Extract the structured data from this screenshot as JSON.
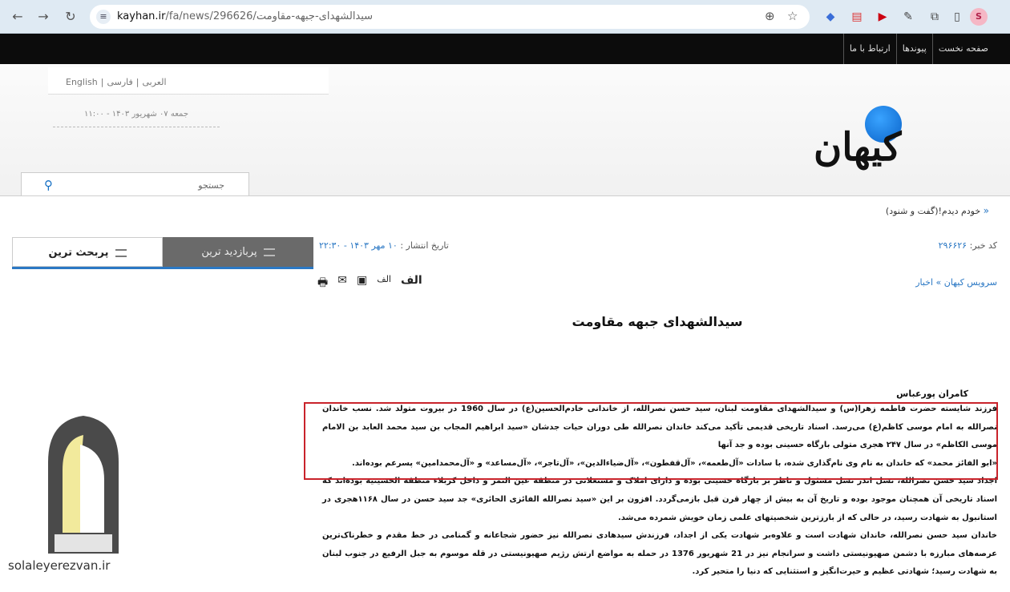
{
  "browser": {
    "domain": "kayhan.ir",
    "path": "/fa/news/296626/سیدالشهدای-جبهه-مقاومت",
    "profile_initial": "S"
  },
  "topnav": [
    "صفحه نخست",
    "پیوندها",
    "ارتباط با ما"
  ],
  "header": {
    "languages": [
      "English",
      "العربی",
      "فارسی"
    ],
    "date": "جمعه ۰۷ شهریور ۱۴۰۳ - ۱۱:۰۰",
    "logo_text": "کیهان",
    "search_label": "جستجو"
  },
  "article": {
    "breadcrumb": "خودم دیدم!(گفت و شنود)",
    "code_label": "کد خبر:",
    "code_value": "۲۹۶۶۲۶",
    "date_label": "تاریخ انتشار :",
    "date_value": "۱۰ مهر ۱۴۰۳ - ۲۲:۳۰",
    "service": "سرویس کیهان » اخبار",
    "title": "سیدالشهدای جبهه مقاومت",
    "author": "کامران پورعباس",
    "paragraphs": [
      "فرزند شایسته حضرت فاطمه زهرا(س) و سیدالشهدای مقاومت لبنان، سید حسن نصرالله، از خاندانی خادم‌الحسین(ع) در سال 1960 در بیروت متولد شد. نسب خاندان نصرالله به امام موسی کاظم(ع) می‌رسد. اسناد تاریخی قدیمی تأکید می‌کند خاندان نصرالله طی دوران حیات جدشان «سید ابراهیم المجاب بن سید محمد العابد بن الامام موسی الکاظم» در سال ۲۴۷ هجری متولی بارگاه حسینی بوده و جد آنها",
      "«ابو الفائز محمد» که خاندان به نام وی نام‌گذاری شده، با سادات «آل‌طعمه»، «آل‌قفطون»، «آل‌ضیاءالدین»، «آل‌تاجر»، «آل‌مساعد» و «آل‌محمدامین» پسرعم بوده‌اند.",
      "اجداد سید حسن نصرالله، نسل اندر نسل مسئول و ناظر بر بارگاه حسینی بوده و دارای املاک و مستغلاتی در منطقه عین التمر و داخل کربلاء منطقه الحسینیه بوده‌اند که اسناد تاریخی آن همچنان موجود بوده و تاریخ آن به بیش از چهار قرن قبل بازمی‌گردد. افزون بر این «سید نصرالله الفائزی الحائری» جد سید حسن در سال ۱۱۶۸هجری در استانبول به شهادت رسید، در حالی که از بارزترین شخصیتهای علمی زمان خویش شمرده می‌شد.",
      "خاندان سید حسن نصرالله، خاندان شهادت است و علاوه‌بر شهادت یکی از اجداد، فرزندش سیدهادی نصرالله نیز حضور شجاعانه و گمنامی در خط مقدم و خطرناک‌ترین عرصه‌های مبارزه با دشمن صهیونیستی داشت و سرانجام نیز در 21 شهریور 1376 در حمله به مواضع ارتش رژیم صهیونیستی در قله موسوم به جبل الرفیع در جنوب لبنان به شهادت رسید؛ شهادتی عظیم و حیرت‌انگیز و استثنایی که دنیا را متحیر کرد."
    ]
  },
  "sidebar": {
    "tab_most_viewed": "پربازدید ترین",
    "tab_most_discussed": "پربحث ترین"
  },
  "watermark": {
    "logo_text": "سلاله رضوان",
    "site": "solaleyerezvan.ir"
  },
  "colors": {
    "accent": "#2b78c4",
    "highlight_box": "#c9232b"
  }
}
